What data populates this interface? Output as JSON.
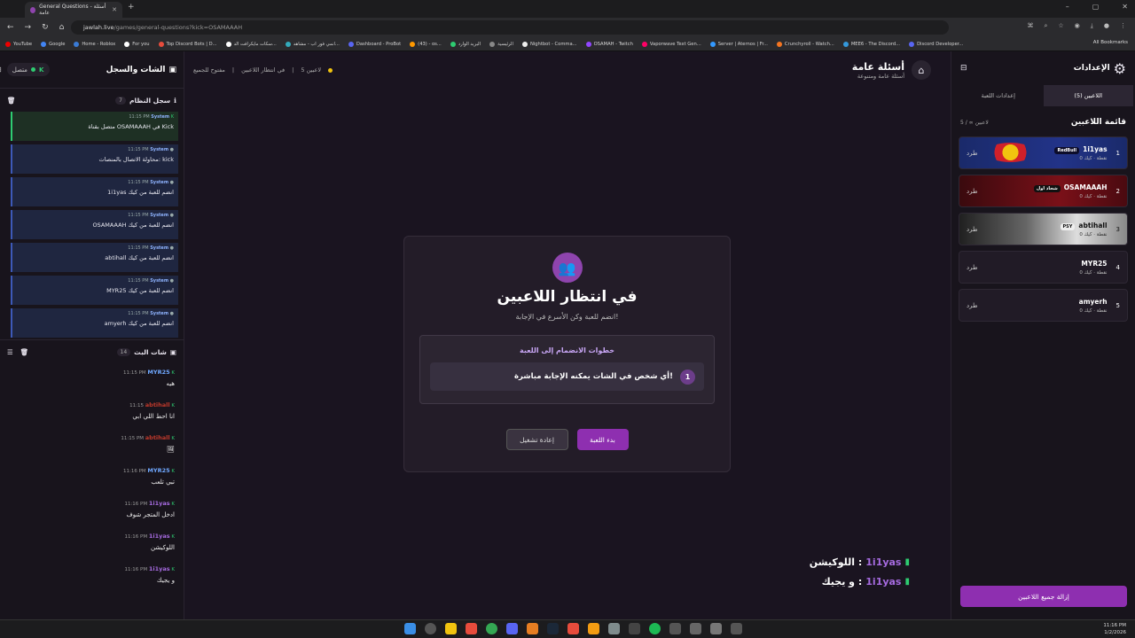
{
  "browser": {
    "tab_title": "General Questions - أسئلة عامة",
    "url_host": "jawlah.live",
    "url_path": "/games/general-questions?kick=OSAMAAAH",
    "bookmarks": [
      "YouTube",
      "Google",
      "Home - Roblox",
      "For you",
      "Top Discord Bots | D...",
      "سكات مايكرافت الد...",
      "انمي فور اب - مشاهد...",
      "Dashboard - ProBot",
      "(43) - os...",
      "البريد الوارد",
      "الرئيسية",
      "Nightbot - Comma...",
      "OSAMAH - Twitch",
      "Vaporwave Text Gen...",
      "Server | Aternos | Fr...",
      "Crunchyroll - Watch...",
      "MEE6 - The Discord...",
      "Discord Developer..."
    ],
    "all_bookmarks": "All Bookmarks"
  },
  "left_panel": {
    "title": "الشات والسجل",
    "status": "متصل",
    "system_log": {
      "title": "سجل النظام",
      "count": "7",
      "messages": [
        {
          "time": "11:15 PM",
          "sender": "System",
          "text": "متصل بقناة OSAMAAAH في Kick"
        },
        {
          "time": "11:15 PM",
          "sender": "System",
          "text": "محاولة الاتصال بالمنصات: kick"
        },
        {
          "time": "11:15 PM",
          "sender": "System",
          "text": "1i1yas انضم للعبة من كيك"
        },
        {
          "time": "11:15 PM",
          "sender": "System",
          "text": "OSAMAAAH انضم للعبة من كيك"
        },
        {
          "time": "11:15 PM",
          "sender": "System",
          "text": "abtihall انضم للعبة من كيك"
        },
        {
          "time": "11:15 PM",
          "sender": "System",
          "text": "MYR25 انضم للعبة من كيك"
        },
        {
          "time": "11:15 PM",
          "sender": "System",
          "text": "amyerh انضم للعبة من كيك"
        }
      ]
    },
    "chat": {
      "title": "شات البث",
      "count": "14",
      "messages": [
        {
          "time": "11:15 PM",
          "user": "MYR25",
          "color": "#6fa8ff",
          "text": "هيه"
        },
        {
          "time": "11:15",
          "user": "abtihall",
          "color": "#c0392b",
          "text": "انا احط اللي ابي"
        },
        {
          "time": "11:15 PM",
          "user": "abtihall",
          "color": "#c0392b",
          "text": "🖼"
        },
        {
          "time": "11:16 PM",
          "user": "MYR25",
          "color": "#6fa8ff",
          "text": "تبي تلعب"
        },
        {
          "time": "11:16 PM",
          "user": "1i1yas",
          "color": "#a66be0",
          "text": "ادخل المتجر شوف"
        },
        {
          "time": "11:16 PM",
          "user": "1i1yas",
          "color": "#a66be0",
          "text": "اللوكيشن"
        },
        {
          "time": "11:16 PM",
          "user": "1i1yas",
          "color": "#a66be0",
          "text": "و يجيك"
        }
      ]
    }
  },
  "center": {
    "game_title": "أسئلة عامة",
    "game_subtitle": "أسئلة عامة ومتنوعة",
    "players_count": "5 لاعبين",
    "waiting_crumb": "في انتظار اللاعبين",
    "open_crumb": "مفتوح للجميع",
    "modal": {
      "title": "في انتظار اللاعبين",
      "subtitle": "انضم للعبة وكن الأسرع في الإجابة!",
      "steps_title": "خطوات الانضمام إلى اللعبة",
      "step_num": "1",
      "step_text": "أي شخص في الشات يمكنه الإجابة مباشرة!",
      "start_label": "بدء اللعبة",
      "restart_label": "إعادة تشغيل"
    },
    "overlay": [
      {
        "text": "اللوكيشن :",
        "user": "1i1yas"
      },
      {
        "text": "و يجيك :",
        "user": "1i1yas"
      }
    ]
  },
  "right_panel": {
    "title": "الإعدادات",
    "tab_players": "اللاعبين (5)",
    "tab_settings": "إعدادات اللعبة",
    "list_title": "قائمة اللاعبين",
    "list_count": "5 / ∞ لاعبين",
    "kick_label": "طرد",
    "players": [
      {
        "rank": "1",
        "name": "1i1yas",
        "badge": "RedBull",
        "points": "0 نقطة · كيك"
      },
      {
        "rank": "2",
        "name": "OSAMAAAH",
        "badge": "شحاذ اول",
        "points": "0 نقطة · كيك"
      },
      {
        "rank": "3",
        "name": "abtihall",
        "badge": "PSY",
        "points": "0 نقطة · كيك"
      },
      {
        "rank": "4",
        "name": "MYR25",
        "badge": "",
        "points": "0 نقطة · كيك"
      },
      {
        "rank": "5",
        "name": "amyerh",
        "badge": "",
        "points": "0 نقطة · كيك"
      }
    ],
    "remove_all": "إزالة جميع اللاعبين"
  },
  "taskbar": {
    "time": "11:16 PM",
    "date": "1/2/2026"
  }
}
